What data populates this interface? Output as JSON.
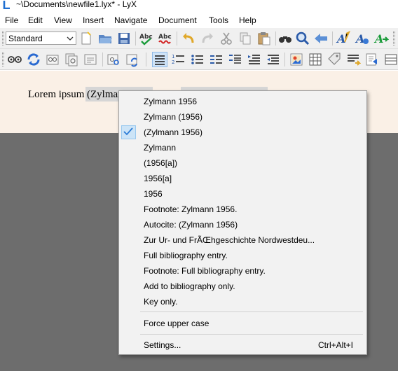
{
  "window": {
    "title": "~\\Documents\\newfile1.lyx* - LyX",
    "app_icon": "lyx-logo"
  },
  "menubar": {
    "items": [
      "File",
      "Edit",
      "View",
      "Insert",
      "Navigate",
      "Document",
      "Tools",
      "Help"
    ]
  },
  "toolbar": {
    "layout_select_value": "Standard",
    "row1_icons": [
      "new-document-icon",
      "open-folder-icon",
      "save-icon",
      "spellcheck-icon",
      "spellcheck-continuous-icon",
      "undo-icon",
      "redo-icon",
      "cut-icon",
      "copy-icon",
      "paste-icon",
      "find-binoculars-icon",
      "find-replace-icon",
      "back-arrow-icon",
      "text-style-icon",
      "text-style-apply-icon",
      "text-style-go-icon"
    ],
    "row2_icons": [
      "view-icon",
      "update-icon",
      "view-other-icon",
      "view-master-icon",
      "view-ps-icon",
      "update-ps-icon",
      "toggle-outline-icon",
      "numbered-list-icon",
      "bullet-list-icon",
      "description-icon",
      "list-icon",
      "indent-icon",
      "outdent-icon",
      "insert-graphics-icon",
      "insert-table-icon",
      "insert-label-icon",
      "insert-ref-icon",
      "insert-include-icon",
      "insert-more-icon"
    ]
  },
  "document": {
    "text_prefix": "Lorem ipsum ",
    "citation_text": "(Zylman"
  },
  "context_menu": {
    "items": [
      {
        "label": "Zylmann 1956",
        "checked": false
      },
      {
        "label": "Zylmann (1956)",
        "checked": false
      },
      {
        "label": "(Zylmann 1956)",
        "checked": true
      },
      {
        "label": "Zylmann",
        "checked": false
      },
      {
        "label": "(1956[a])",
        "checked": false
      },
      {
        "label": "1956[a]",
        "checked": false
      },
      {
        "label": "1956",
        "checked": false
      },
      {
        "label": "Footnote: Zylmann 1956.",
        "checked": false
      },
      {
        "label": "Autocite: (Zylmann 1956)",
        "checked": false
      },
      {
        "label": "Zur Ur- und FrÃŒhgeschichte Nordwestdeu...",
        "checked": false
      },
      {
        "label": "Full bibliography entry.",
        "checked": false
      },
      {
        "label": "Footnote: Full bibliography entry.",
        "checked": false
      },
      {
        "label": "Add to bibliography only.",
        "checked": false
      },
      {
        "label": "Key only.",
        "checked": false
      }
    ],
    "force_upper_case": "Force upper case",
    "settings": {
      "label": "Settings...",
      "shortcut": "Ctrl+Alt+I"
    }
  },
  "colors": {
    "document_background": "#faf0e6",
    "workspace_background": "#6d6d6d",
    "menu_background": "#f2f2f2",
    "check_accent": "#2b7bd6"
  }
}
